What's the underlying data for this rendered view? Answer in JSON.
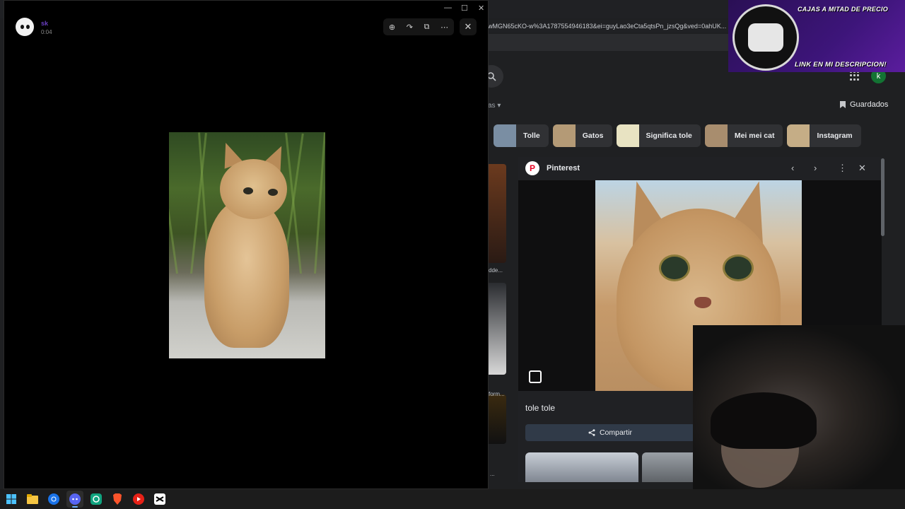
{
  "browser": {
    "url": "wMGN65cKO-w%3A1787554946183&ei=guyLao3eCta5qtsPn_jzsQg&ved=0ahUK...",
    "tools_label": "as ▾",
    "saved_label": "Guardados",
    "account_initial": "k"
  },
  "chips": [
    {
      "label": "Tolle",
      "color": "#7a8ea3"
    },
    {
      "label": "Gatos",
      "color": "#b49a76"
    },
    {
      "label": "Significa tole",
      "color": "#e8e3c2"
    },
    {
      "label": "Mei mei cat",
      "color": "#a88d6e"
    },
    {
      "label": "Instagram",
      "color": "#c5ad86"
    }
  ],
  "strip_labels": [
    "dde...",
    "form...",
    "..."
  ],
  "panel": {
    "source": "Pinterest",
    "title": "tole tole",
    "share_label": "Compartir"
  },
  "banner": {
    "top_text": "CAJAS A MITAD DE PRECIO",
    "bottom_text": "LINK EN MI DESCRIPCION!"
  },
  "viewer": {
    "username": "sk",
    "time": "0:04"
  },
  "taskbar": {
    "icons": [
      "windows-start-icon",
      "file-explorer-icon",
      "chrome-icon",
      "discord-icon",
      "app-icon",
      "brave-icon",
      "youtube-icon",
      "capcut-icon"
    ]
  }
}
